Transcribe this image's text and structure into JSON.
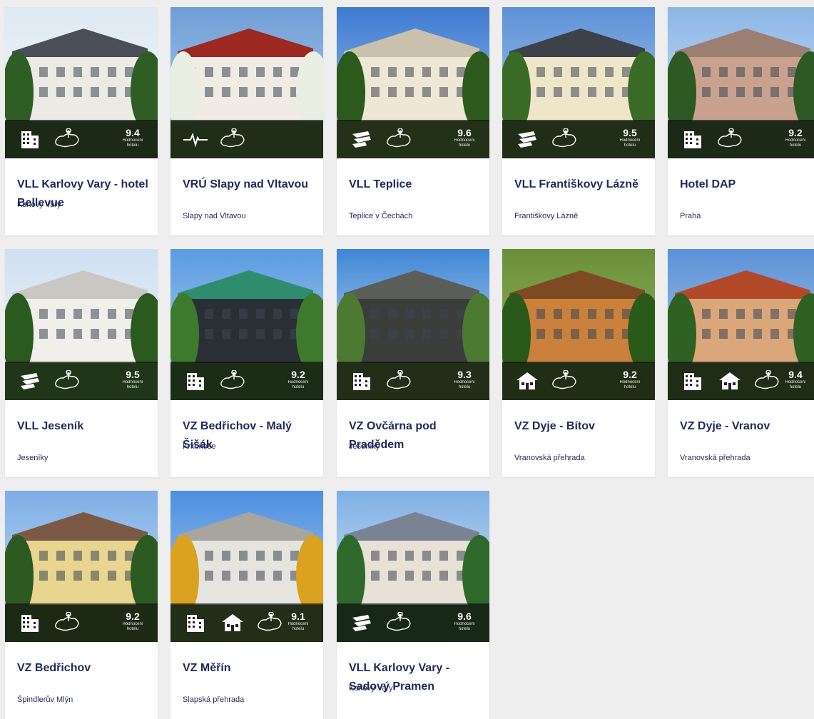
{
  "rating_label": "Hodnocení hotelu",
  "colors": {
    "title": "#1f2a5c",
    "background": "#eeeeee",
    "overlay": "#0f0f0f"
  },
  "cards": [
    {
      "title": "VLL Karlovy Vary - hotel Bellevue",
      "location": "Karlovy Vary",
      "rating": "9.4",
      "icons": [
        "hotel-icon",
        "map-pin-icon"
      ]
    },
    {
      "title": "VRÚ Slapy nad Vltavou",
      "location": "Slapy nad Vltavou",
      "rating": "",
      "icons": [
        "health-pulse-icon",
        "map-pin-icon"
      ]
    },
    {
      "title": "VLL Teplice",
      "location": "Teplice v Čechách",
      "rating": "9.6",
      "icons": [
        "spa-hands-icon",
        "map-pin-icon"
      ]
    },
    {
      "title": "VLL Františkovy Lázně",
      "location": "Františkovy Lázně",
      "rating": "9.5",
      "icons": [
        "spa-hands-icon",
        "map-pin-icon"
      ]
    },
    {
      "title": "Hotel DAP",
      "location": "Praha",
      "rating": "9.2",
      "icons": [
        "hotel-icon",
        "map-pin-icon"
      ]
    },
    {
      "title": "VLL Jeseník",
      "location": "Jeseníky",
      "rating": "9.5",
      "icons": [
        "spa-hands-icon",
        "map-pin-icon"
      ]
    },
    {
      "title": "VZ Bedřichov - Malý Šišák",
      "location": "Krkonoše",
      "rating": "9.2",
      "icons": [
        "hotel-icon",
        "map-pin-icon"
      ]
    },
    {
      "title": "VZ Ovčárna pod Pradědem",
      "location": "Jeseníky",
      "rating": "9.3",
      "icons": [
        "hotel-icon",
        "map-pin-icon"
      ]
    },
    {
      "title": "VZ Dyje - Bítov",
      "location": "Vranovská přehrada",
      "rating": "9.2",
      "icons": [
        "chalet-icon",
        "map-pin-icon"
      ]
    },
    {
      "title": "VZ Dyje - Vranov",
      "location": "Vranovská přehrada",
      "rating": "9.4",
      "icons": [
        "hotel-icon",
        "chalet-icon",
        "map-pin-icon"
      ]
    },
    {
      "title": "VZ Bedřichov",
      "location": "Špindlerův Mlýn",
      "rating": "9.2",
      "icons": [
        "hotel-icon",
        "map-pin-icon"
      ]
    },
    {
      "title": "VZ Měřín",
      "location": "Slapská přehrada",
      "rating": "9.1",
      "icons": [
        "hotel-icon",
        "chalet-icon",
        "map-pin-icon"
      ]
    },
    {
      "title": "VLL Karlovy Vary - Sadový Pramen",
      "location": "Karlovy Vary",
      "rating": "9.6",
      "icons": [
        "spa-hands-icon",
        "map-pin-icon"
      ]
    }
  ]
}
